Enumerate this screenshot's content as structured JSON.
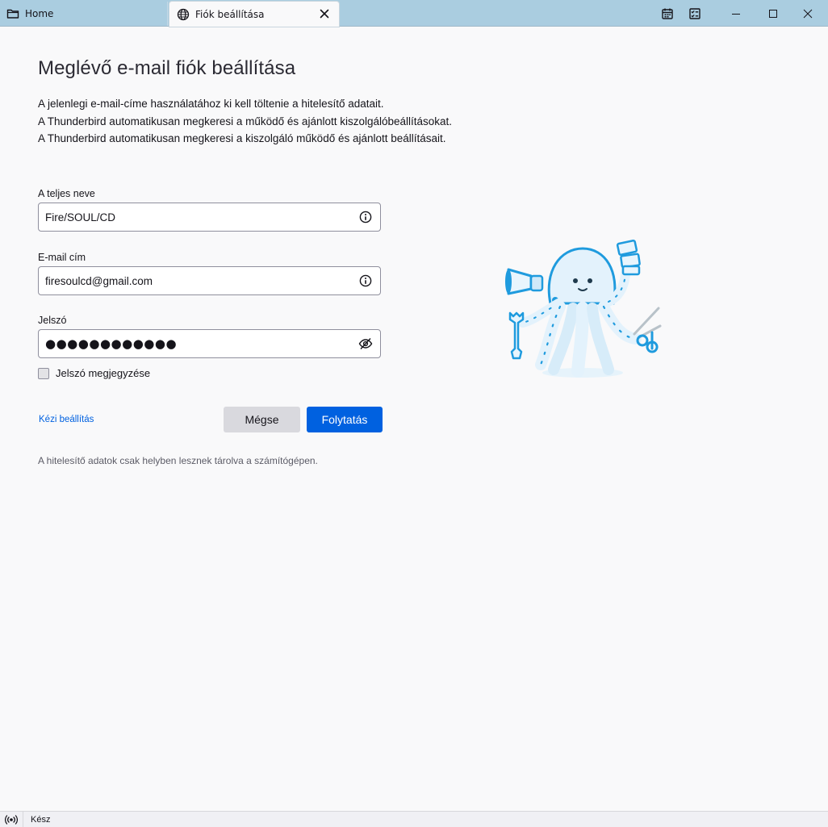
{
  "tabs": {
    "home_label": "Home",
    "active_label": "Fiók beállítása"
  },
  "icons": {
    "home": "folder-icon",
    "active_tab": "globe-icon",
    "tab_close": "close-icon",
    "calendar": "calendar-icon",
    "tasks": "tasks-icon",
    "minimize": "minimize-icon",
    "maximize": "maximize-icon",
    "close": "close-icon",
    "info": "info-icon",
    "password_toggle": "eye-slash-icon",
    "status": "activity-icon"
  },
  "page": {
    "title": "Meglévő e-mail fiók beállítása",
    "intro": [
      "A jelenlegi e-mail-címe használatához ki kell töltenie a hitelesítő adatait.",
      "A Thunderbird automatikusan megkeresi a működő és ajánlott kiszolgálóbeállításokat.",
      "A Thunderbird automatikusan megkeresi a kiszolgáló működő és ajánlott beállításait."
    ]
  },
  "form": {
    "name_label": "A teljes neve",
    "name_value": "Fire/SOUL/CD",
    "email_label": "E-mail cím",
    "email_value": "firesoulcd@gmail.com",
    "password_label": "Jelszó",
    "password_mask": "●●●●●●●●●●●●",
    "remember_label": "Jelszó megjegyzése",
    "remember_checked": false
  },
  "actions": {
    "manual_label": "Kézi beállítás",
    "cancel_label": "Mégse",
    "continue_label": "Folytatás"
  },
  "note": "A hitelesítő adatok csak helyben lesznek tárolva a számítógépen.",
  "status": {
    "text": "Kész"
  },
  "colors": {
    "accent": "#0061e0",
    "titlebar": "#aacde0",
    "illustration_blue": "#1f9bde"
  }
}
